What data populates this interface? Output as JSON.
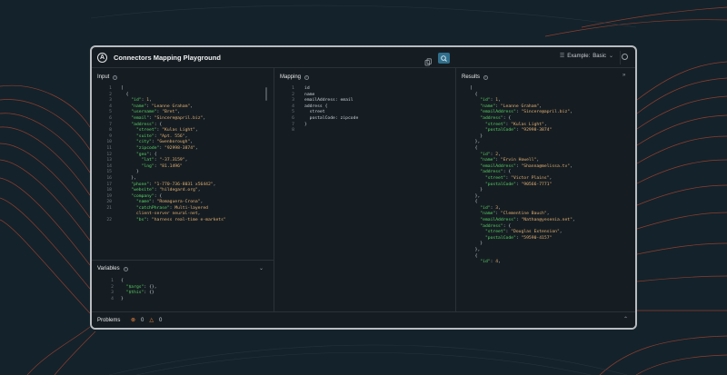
{
  "app": {
    "title": "Connectors Mapping Playground",
    "logo_letter": "A"
  },
  "header": {
    "example_label": "Example:",
    "example_value": "Basic"
  },
  "panels": {
    "input": {
      "title": "Input"
    },
    "variables": {
      "title": "Variables"
    },
    "mapping": {
      "title": "Mapping"
    },
    "results": {
      "title": "Results"
    },
    "problems": {
      "title": "Problems",
      "errors": "0",
      "warnings": "0"
    }
  },
  "input_lines": [
    "[",
    "  {",
    "    \"id\": 1,",
    "    \"name\": \"Leanne Graham\",",
    "    \"username\": \"Bret\",",
    "    \"email\": \"Sincere@april.biz\",",
    "    \"address\": {",
    "      \"street\": \"Kulas Light\",",
    "      \"suite\": \"Apt. 556\",",
    "      \"city\": \"Gwenborough\",",
    "      \"zipcode\": \"92998-3874\",",
    "      \"geo\": {",
    "        \"lat\": \"-37.3159\",",
    "        \"lng\": \"81.1496\"",
    "      }",
    "    },",
    "    \"phone\": \"1-770-736-8031 x56442\",",
    "    \"website\": \"hildegard.org\",",
    "    \"company\": {",
    "      \"name\": \"Romaguera-Crona\",",
    "      \"catchPhrase\": \"Multi-layered",
    "      client-server neural-net\",",
    "      \"bs\": \"harness real-time e-markets\""
  ],
  "input_line_numbers": [
    "1",
    "2",
    "3",
    "4",
    "5",
    "6",
    "7",
    "8",
    "9",
    "10",
    "11",
    "12",
    "13",
    "14",
    "15",
    "16",
    "17",
    "18",
    "19",
    "20",
    "21",
    "",
    "22"
  ],
  "variables_lines": [
    "{",
    "  \"$args\": {},",
    "  \"$this\": {}",
    "}"
  ],
  "variables_line_numbers": [
    "1",
    "2",
    "3",
    "4"
  ],
  "mapping_lines": [
    "id",
    "name",
    "emailAddress: email",
    "address {",
    "  street",
    "  postalCode: zipcode",
    "}",
    ""
  ],
  "mapping_line_numbers": [
    "1",
    "2",
    "3",
    "4",
    "5",
    "6",
    "7",
    "8"
  ],
  "results_lines": [
    "[",
    "  {",
    "    \"id\": 1,",
    "    \"name\": \"Leanne Graham\",",
    "    \"emailAddress\": \"Sincere@april.biz\",",
    "    \"address\": {",
    "      \"street\": \"Kulas Light\",",
    "      \"postalCode\": \"92998-3874\"",
    "    }",
    "  },",
    "  {",
    "    \"id\": 2,",
    "    \"name\": \"Ervin Howell\",",
    "    \"emailAddress\": \"Shanna@melissa.tv\",",
    "    \"address\": {",
    "      \"street\": \"Victor Plains\",",
    "      \"postalCode\": \"90566-7771\"",
    "    }",
    "  },",
    "  {",
    "    \"id\": 3,",
    "    \"name\": \"Clementine Bauch\",",
    "    \"emailAddress\": \"Nathan@yesenia.net\",",
    "    \"address\": {",
    "      \"street\": \"Douglas Extension\",",
    "      \"postalCode\": \"59590-4157\"",
    "    }",
    "  },",
    "  {",
    "    \"id\": 4,"
  ],
  "colors": {
    "background": "#14222b",
    "key": "#56d364",
    "string": "#e3b073",
    "accent_button": "#2f6f8c",
    "deco_lines": "#c44a2e"
  }
}
